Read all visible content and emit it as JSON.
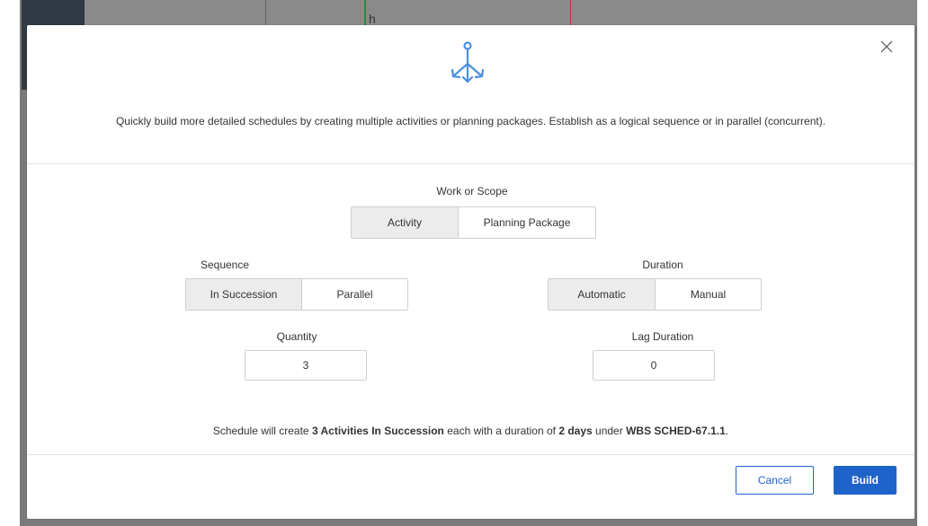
{
  "background": {
    "visible_glyph": "h"
  },
  "modal": {
    "hero_icon": "branch-split-icon",
    "intro": "Quickly build more detailed schedules by creating multiple activities or planning packages. Establish as a logical sequence or in parallel (concurrent).",
    "close_icon": "close-icon",
    "work_scope": {
      "label": "Work or Scope",
      "options": [
        "Activity",
        "Planning Package"
      ],
      "selected": "Activity"
    },
    "sequence": {
      "label": "Sequence",
      "options": [
        "In Succession",
        "Parallel"
      ],
      "selected": "In Succession"
    },
    "duration": {
      "label": "Duration",
      "options": [
        "Automatic",
        "Manual"
      ],
      "selected": "Automatic"
    },
    "quantity": {
      "label": "Quantity",
      "value": "3"
    },
    "lag_duration": {
      "label": "Lag Duration",
      "value": "0"
    },
    "summary": {
      "prefix": "Schedule will create",
      "count_type": "3 Activities In Succession",
      "middle": "each with a duration of",
      "duration": "2 days",
      "under": "under",
      "wbs": "WBS SCHED-67.1.1",
      "suffix": "."
    },
    "footer": {
      "cancel_label": "Cancel",
      "build_label": "Build"
    }
  },
  "colors": {
    "accent": "#1e63c9",
    "icon": "#4a8fe0",
    "selected_segment": "#ececec"
  }
}
